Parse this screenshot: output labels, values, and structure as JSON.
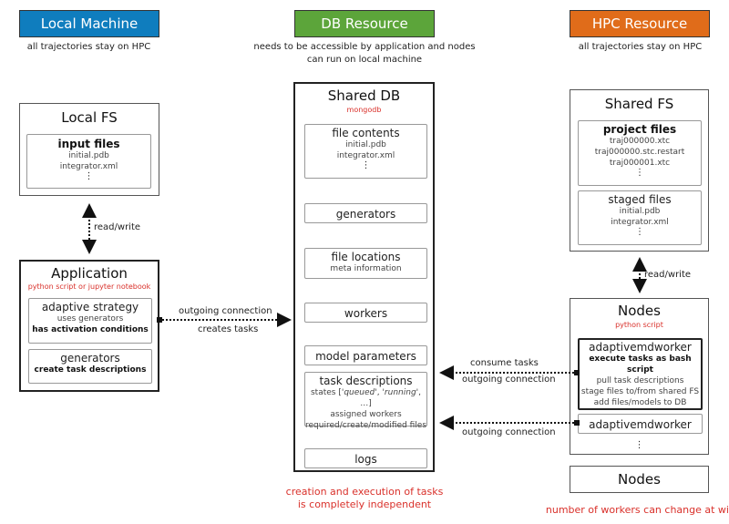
{
  "columns": {
    "local": {
      "header": "Local Machine",
      "subtitle": "all trajectories stay on HPC",
      "color": "#0f7dbe"
    },
    "db": {
      "header": "DB Resource",
      "subtitle_lines": [
        "needs to be accessible by application and nodes",
        "can run on local machine"
      ],
      "color": "#5ca53a"
    },
    "hpc": {
      "header": "HPC Resource",
      "subtitle": "all trajectories stay on HPC",
      "color": "#e06c1a"
    }
  },
  "local_fs": {
    "title": "Local FS",
    "input_files": {
      "title": "input files",
      "items": [
        "initial.pdb",
        "integrator.xml"
      ],
      "more": "⋮"
    }
  },
  "application": {
    "title": "Application",
    "subtitle": "python script or jupyter notebook",
    "adaptive_strategy": {
      "title": "adaptive strategy",
      "line1": "uses generators",
      "line2": "has activation conditions"
    },
    "generators": {
      "title": "generators",
      "line1": "create task descriptions"
    }
  },
  "shared_db": {
    "title": "Shared DB",
    "subtitle": "mongodb",
    "file_contents": {
      "title": "file contents",
      "items": [
        "initial.pdb",
        "integrator.xml"
      ],
      "more": "⋮"
    },
    "generators": "generators",
    "file_locations": {
      "title": "file locations",
      "line1": "meta information"
    },
    "workers": "workers",
    "model_parameters": "model parameters",
    "task_descriptions": {
      "title": "task descriptions",
      "states_prefix": "states [",
      "state1": "'queued'",
      "sep": ", ",
      "state2": "'running'",
      "states_suffix": ", …]",
      "line2": "assigned workers",
      "line3": "required/create/modified files"
    },
    "logs": "logs",
    "footnote_lines": [
      "creation and execution of tasks",
      "is completely independent"
    ]
  },
  "shared_fs": {
    "title": "Shared FS",
    "project_files": {
      "title": "project files",
      "items": [
        "traj000000.xtc",
        "traj000000.stc.restart",
        "traj000001.xtc"
      ],
      "more": "⋮"
    },
    "staged_files": {
      "title": "staged files",
      "items": [
        "initial.pdb",
        "integrator.xml"
      ],
      "more": "⋮"
    }
  },
  "nodes": {
    "title": "Nodes",
    "subtitle": "python script",
    "worker1": {
      "title": "adaptivemdworker",
      "line1": "execute tasks as bash script",
      "line2": "pull task descriptions",
      "line3": "stage files to/from shared FS",
      "line4": "add files/models to DB"
    },
    "worker2": {
      "title": "adaptivemdworker"
    },
    "more": "⋮"
  },
  "nodes2": {
    "title": "Nodes"
  },
  "hpc_footnote": "number of workers can change at will",
  "connections": {
    "local_rw": "read/write",
    "app_out_line1": "outgoing connection",
    "app_out_line2": "creates tasks",
    "hpc_rw": "read/write",
    "worker_line1": "consume tasks",
    "worker_line2": "outgoing connection",
    "worker2_line": "outgoing connection"
  }
}
